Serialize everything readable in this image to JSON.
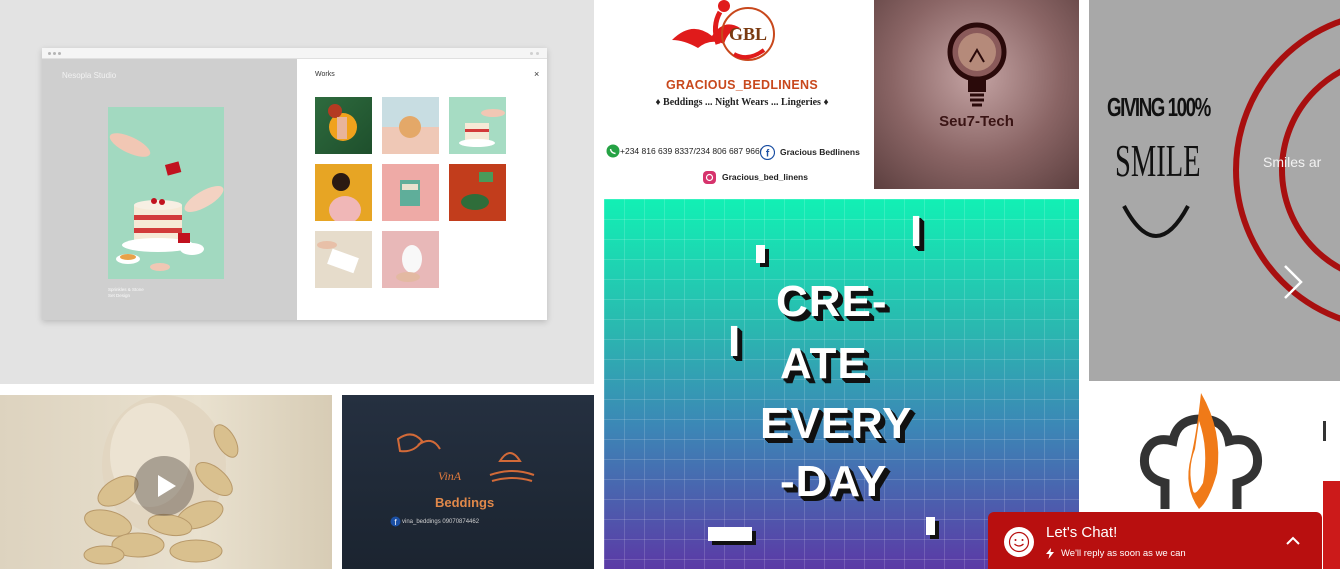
{
  "gallery": {
    "studio_mockup": {
      "studio_name": "Nesopla Studio",
      "works_title": "Works",
      "close_symbol": "×",
      "caption_line1": "Sprinkles & Stone",
      "caption_line2": "Set Design"
    },
    "gracious": {
      "brand": "GRACIOUS_BEDLINENS",
      "tagline": "♦ Beddings ... Night Wears ... Lingeries ♦",
      "phone": "+234 816 639 8337/234 806 687 9666",
      "facebook": "Gracious Bedlinens",
      "instagram": "Gracious_bed_linens",
      "logo_letters": "GBL"
    },
    "seu7": {
      "name": "Seu7-Tech"
    },
    "smile": {
      "giving": "GIVING 100%",
      "smile_word": "SMILE",
      "caption": "Smiles ar"
    },
    "vina": {
      "script": "VinA",
      "name": "Beddings",
      "contact": "vina_beddings   09070874462"
    },
    "poster": {
      "letter_i": "I",
      "line1": "CRE-",
      "line2": "ATE",
      "line3": "EVERY",
      "line4": "-DAY"
    }
  },
  "chat": {
    "title": "Let's Chat!",
    "subtitle": "We'll reply as soon as we can"
  },
  "colors": {
    "chat_bg": "#b80f0f",
    "gracious_red": "#e01b1b",
    "gracious_orange": "#c8481c",
    "seu7_text": "#3a1414",
    "smile_red": "#a80f0f",
    "chef_orange": "#f07a18"
  },
  "icons": {
    "play": "play-icon",
    "next": "chevron-right-icon",
    "chat_toggle": "chevron-up-icon",
    "chat_avatar": "smiley-icon",
    "bolt": "lightning-icon",
    "bulb": "lightbulb-icon",
    "chef_hat": "chef-hat-icon",
    "whatsapp": "whatsapp-icon",
    "facebook": "facebook-icon",
    "instagram": "instagram-icon"
  }
}
